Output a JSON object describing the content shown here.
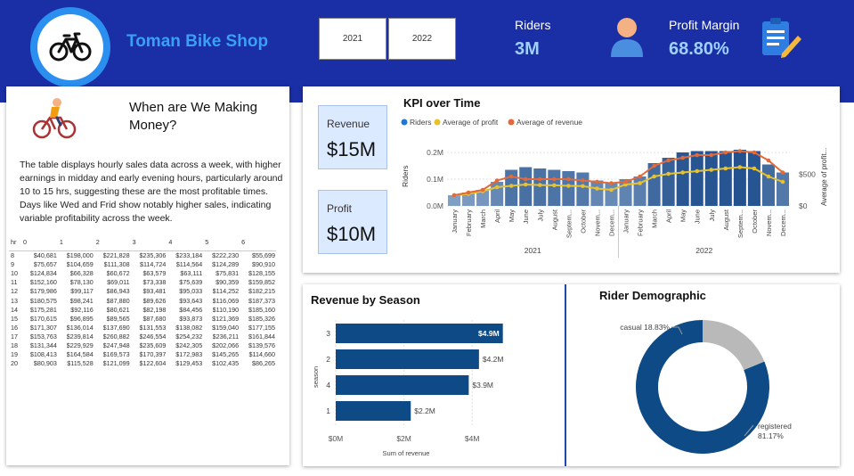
{
  "header": {
    "brand": "Toman Bike Shop",
    "year_buttons": [
      "2021",
      "2022"
    ],
    "riders_label": "Riders",
    "riders_value": "3M",
    "margin_label": "Profit Margin",
    "margin_value": "68.80%",
    "colors": {
      "background": "#1a2fa5",
      "brand_text": "#3aa0f5",
      "kpi_value": "#9fd0ff"
    }
  },
  "left_panel": {
    "title": "When are We Making Money?",
    "description": "The table displays hourly sales data across a week, with higher earnings in midday and early evening hours, particularly around 10 to 15 hrs, suggesting these are the most profitable times. Days like Wed and Frid show notably higher sales, indicating variable profitability across the week.",
    "table": {
      "headers": [
        "hr",
        "0",
        "1",
        "2",
        "3",
        "4",
        "5",
        "6"
      ],
      "rows": [
        [
          "8",
          "$40,681",
          "$198,000",
          "$221,828",
          "$235,306",
          "$233,184",
          "$222,230",
          "$55,699"
        ],
        [
          "9",
          "$75,657",
          "$104,659",
          "$111,308",
          "$114,724",
          "$114,564",
          "$124,289",
          "$90,910"
        ],
        [
          "10",
          "$124,834",
          "$66,328",
          "$60,672",
          "$63,579",
          "$63,111",
          "$75,831",
          "$128,155"
        ],
        [
          "11",
          "$152,160",
          "$78,130",
          "$69,011",
          "$73,338",
          "$75,639",
          "$90,359",
          "$159,852"
        ],
        [
          "12",
          "$179,986",
          "$99,117",
          "$86,943",
          "$93,481",
          "$95,033",
          "$114,252",
          "$182,215"
        ],
        [
          "13",
          "$180,575",
          "$98,241",
          "$87,880",
          "$89,626",
          "$93,643",
          "$116,069",
          "$187,373"
        ],
        [
          "14",
          "$175,281",
          "$92,116",
          "$80,621",
          "$82,198",
          "$84,456",
          "$110,190",
          "$185,160"
        ],
        [
          "15",
          "$170,615",
          "$96,895",
          "$89,565",
          "$87,680",
          "$93,873",
          "$121,369",
          "$185,326"
        ],
        [
          "16",
          "$171,307",
          "$136,014",
          "$137,690",
          "$131,553",
          "$138,082",
          "$159,040",
          "$177,155"
        ],
        [
          "17",
          "$153,763",
          "$239,814",
          "$260,882",
          "$246,554",
          "$254,232",
          "$236,211",
          "$161,844"
        ],
        [
          "18",
          "$131,344",
          "$229,929",
          "$247,948",
          "$235,609",
          "$242,305",
          "$202,066",
          "$139,576"
        ],
        [
          "19",
          "$108,413",
          "$164,584",
          "$169,573",
          "$170,397",
          "$172,983",
          "$145,265",
          "$114,660"
        ],
        [
          "20",
          "$80,903",
          "$115,528",
          "$121,099",
          "$122,604",
          "$129,453",
          "$102,435",
          "$86,265"
        ]
      ]
    }
  },
  "kpi_panel": {
    "title": "KPI over Time",
    "revenue_label": "Revenue",
    "revenue_value": "$15M",
    "profit_label": "Profit",
    "profit_value": "$10M",
    "legend": [
      "Riders",
      "Average of profit",
      "Average of revenue"
    ]
  },
  "season_panel": {
    "title": "Revenue by Season"
  },
  "demo_panel": {
    "title": "Rider Demographic"
  },
  "chart_data": [
    {
      "type": "combo-bar-line",
      "title": "KPI over Time",
      "categories": [
        "January",
        "February",
        "March",
        "April",
        "May",
        "June",
        "July",
        "August",
        "Septem...",
        "October",
        "Novem...",
        "Decem...",
        "January",
        "February",
        "March",
        "April",
        "May",
        "June",
        "July",
        "August",
        "Septem...",
        "October",
        "Novem...",
        "Decem..."
      ],
      "groups": [
        {
          "label": "2021",
          "count": 12
        },
        {
          "label": "2022",
          "count": 12
        }
      ],
      "ylabel": "Riders",
      "y2label": "Average of profit...",
      "yticks": [
        "0.0M",
        "0.1M",
        "0.2M"
      ],
      "ylim": [
        0,
        0.22
      ],
      "y2ticks": [
        "$0",
        "$500"
      ],
      "y2lim": [
        0,
        1000
      ],
      "series": [
        {
          "name": "Riders",
          "type": "bar",
          "axis": "left",
          "color": "#1f4e8c",
          "values": [
            0.04,
            0.05,
            0.06,
            0.09,
            0.135,
            0.145,
            0.14,
            0.135,
            0.13,
            0.125,
            0.095,
            0.085,
            0.1,
            0.11,
            0.16,
            0.18,
            0.2,
            0.205,
            0.205,
            0.205,
            0.21,
            0.205,
            0.155,
            0.125
          ]
        },
        {
          "name": "Average of profit",
          "type": "line",
          "axis": "left",
          "color": "#e8c22e",
          "values": [
            0.04,
            0.045,
            0.055,
            0.07,
            0.075,
            0.08,
            0.078,
            0.077,
            0.075,
            0.074,
            0.065,
            0.06,
            0.08,
            0.085,
            0.11,
            0.12,
            0.125,
            0.13,
            0.135,
            0.14,
            0.145,
            0.14,
            0.11,
            0.09
          ]
        },
        {
          "name": "Average of revenue",
          "type": "line",
          "axis": "left",
          "color": "#e26a3a",
          "values": [
            0.04,
            0.05,
            0.06,
            0.095,
            0.11,
            0.1,
            0.1,
            0.1,
            0.1,
            0.095,
            0.09,
            0.085,
            0.09,
            0.11,
            0.15,
            0.17,
            0.18,
            0.19,
            0.19,
            0.2,
            0.205,
            0.2,
            0.17,
            0.125
          ]
        }
      ]
    },
    {
      "type": "bar",
      "orientation": "horizontal",
      "title": "Revenue by Season",
      "categories": [
        "3",
        "2",
        "4",
        "1"
      ],
      "values": [
        4.9,
        4.2,
        3.9,
        2.2
      ],
      "labels": [
        "$4.9M",
        "$4.2M",
        "$3.9M",
        "$2.2M"
      ],
      "xlabel": "Sum of revenue",
      "ylabel": "season",
      "xticks": [
        "$0M",
        "$2M",
        "$4M"
      ],
      "xlim": [
        0,
        5.3
      ],
      "color": "#0d4a86"
    },
    {
      "type": "pie",
      "donut": true,
      "title": "Rider Demographic",
      "labels": [
        "casual",
        "registered"
      ],
      "values": [
        18.83,
        81.17
      ],
      "label_text": [
        "casual 18.83%",
        "registered",
        "81.17%"
      ],
      "colors": [
        "#b9b9b9",
        "#0d4a86"
      ]
    }
  ]
}
